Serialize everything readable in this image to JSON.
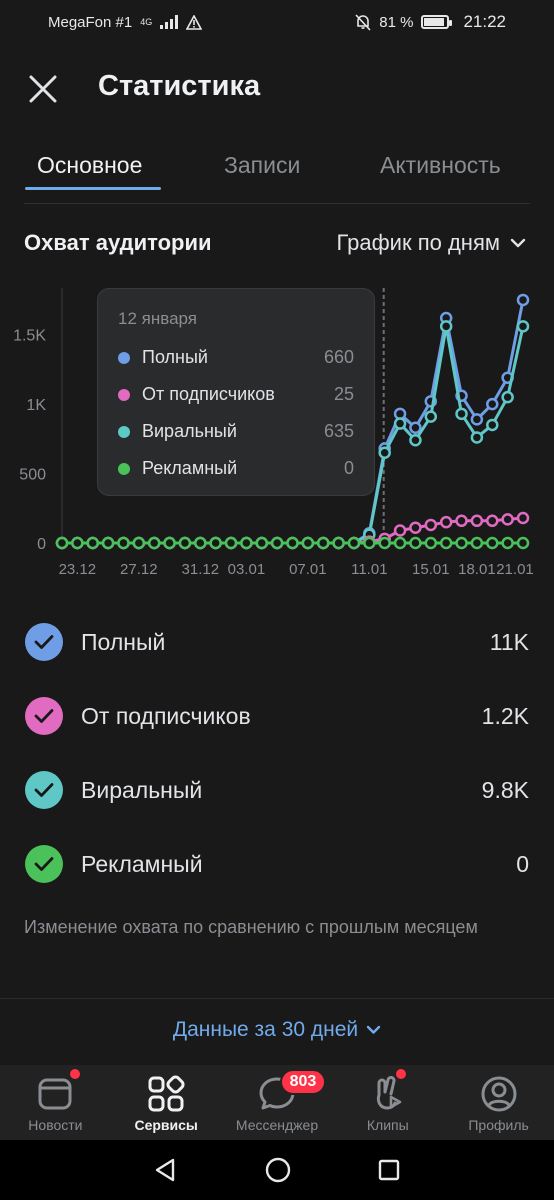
{
  "status_bar": {
    "carrier": "MegaFon #1",
    "network": "4G",
    "battery": "81 %",
    "time": "21:22"
  },
  "header": {
    "title": "Статистика"
  },
  "tabs": [
    {
      "label": "Основное",
      "active": true
    },
    {
      "label": "Записи",
      "active": false
    },
    {
      "label": "Активность",
      "active": false
    }
  ],
  "section": {
    "title": "Охват аудитории",
    "period_select": "График по дням"
  },
  "tooltip": {
    "date": "12 января",
    "rows": [
      {
        "name": "Полный",
        "value": "660",
        "color": "#6f9de6"
      },
      {
        "name": "От подписчиков",
        "value": "25",
        "color": "#e06bc0"
      },
      {
        "name": "Виральный",
        "value": "635",
        "color": "#5fc8c6"
      },
      {
        "name": "Рекламный",
        "value": "0",
        "color": "#4bc15a"
      }
    ]
  },
  "chart_data": {
    "type": "line",
    "x_ticks": [
      "23.12",
      "27.12",
      "31.12",
      "03.01",
      "07.01",
      "11.01",
      "15.01",
      "18.01",
      "21.01"
    ],
    "y_ticks": [
      "0",
      "500",
      "1K",
      "1.5K"
    ],
    "ylim": [
      0,
      1800
    ],
    "series": [
      {
        "name": "Полный",
        "color": "#6f9de6",
        "values": [
          0,
          0,
          0,
          0,
          0,
          0,
          0,
          0,
          0,
          0,
          0,
          0,
          0,
          0,
          0,
          0,
          0,
          0,
          0,
          0,
          70,
          680,
          930,
          830,
          1020,
          1620,
          1060,
          890,
          1000,
          1190,
          1750
        ]
      },
      {
        "name": "Виральный",
        "color": "#5fc8c6",
        "values": [
          0,
          0,
          0,
          0,
          0,
          0,
          0,
          0,
          0,
          0,
          0,
          0,
          0,
          0,
          0,
          0,
          0,
          0,
          0,
          0,
          60,
          650,
          860,
          740,
          910,
          1560,
          930,
          760,
          850,
          1050,
          1560
        ]
      },
      {
        "name": "От подписчиков",
        "color": "#e06bc0",
        "values": [
          0,
          0,
          0,
          0,
          0,
          0,
          0,
          0,
          0,
          0,
          0,
          0,
          0,
          0,
          0,
          0,
          0,
          0,
          0,
          0,
          10,
          30,
          90,
          110,
          130,
          150,
          160,
          160,
          160,
          170,
          180
        ]
      },
      {
        "name": "Рекламный",
        "color": "#4bc15a",
        "values": [
          0,
          0,
          0,
          0,
          0,
          0,
          0,
          0,
          0,
          0,
          0,
          0,
          0,
          0,
          0,
          0,
          0,
          0,
          0,
          0,
          0,
          0,
          0,
          0,
          0,
          0,
          0,
          0,
          0,
          0,
          0
        ]
      }
    ]
  },
  "legend": [
    {
      "name": "Полный",
      "value": "11K",
      "color": "#6f9de6"
    },
    {
      "name": "От подписчиков",
      "value": "1.2K",
      "color": "#e06bc0"
    },
    {
      "name": "Виральный",
      "value": "9.8K",
      "color": "#5fc8c6"
    },
    {
      "name": "Рекламный",
      "value": "0",
      "color": "#4bc15a"
    }
  ],
  "note": "Изменение охвата по сравнению с прошлым месяцем",
  "more_link": "Данные за 30 дней",
  "bottom_nav": [
    {
      "label": "Новости",
      "active": false
    },
    {
      "label": "Сервисы",
      "active": true
    },
    {
      "label": "Мессенджер",
      "active": false,
      "badge": "803"
    },
    {
      "label": "Клипы",
      "active": false
    },
    {
      "label": "Профиль",
      "active": false
    }
  ]
}
